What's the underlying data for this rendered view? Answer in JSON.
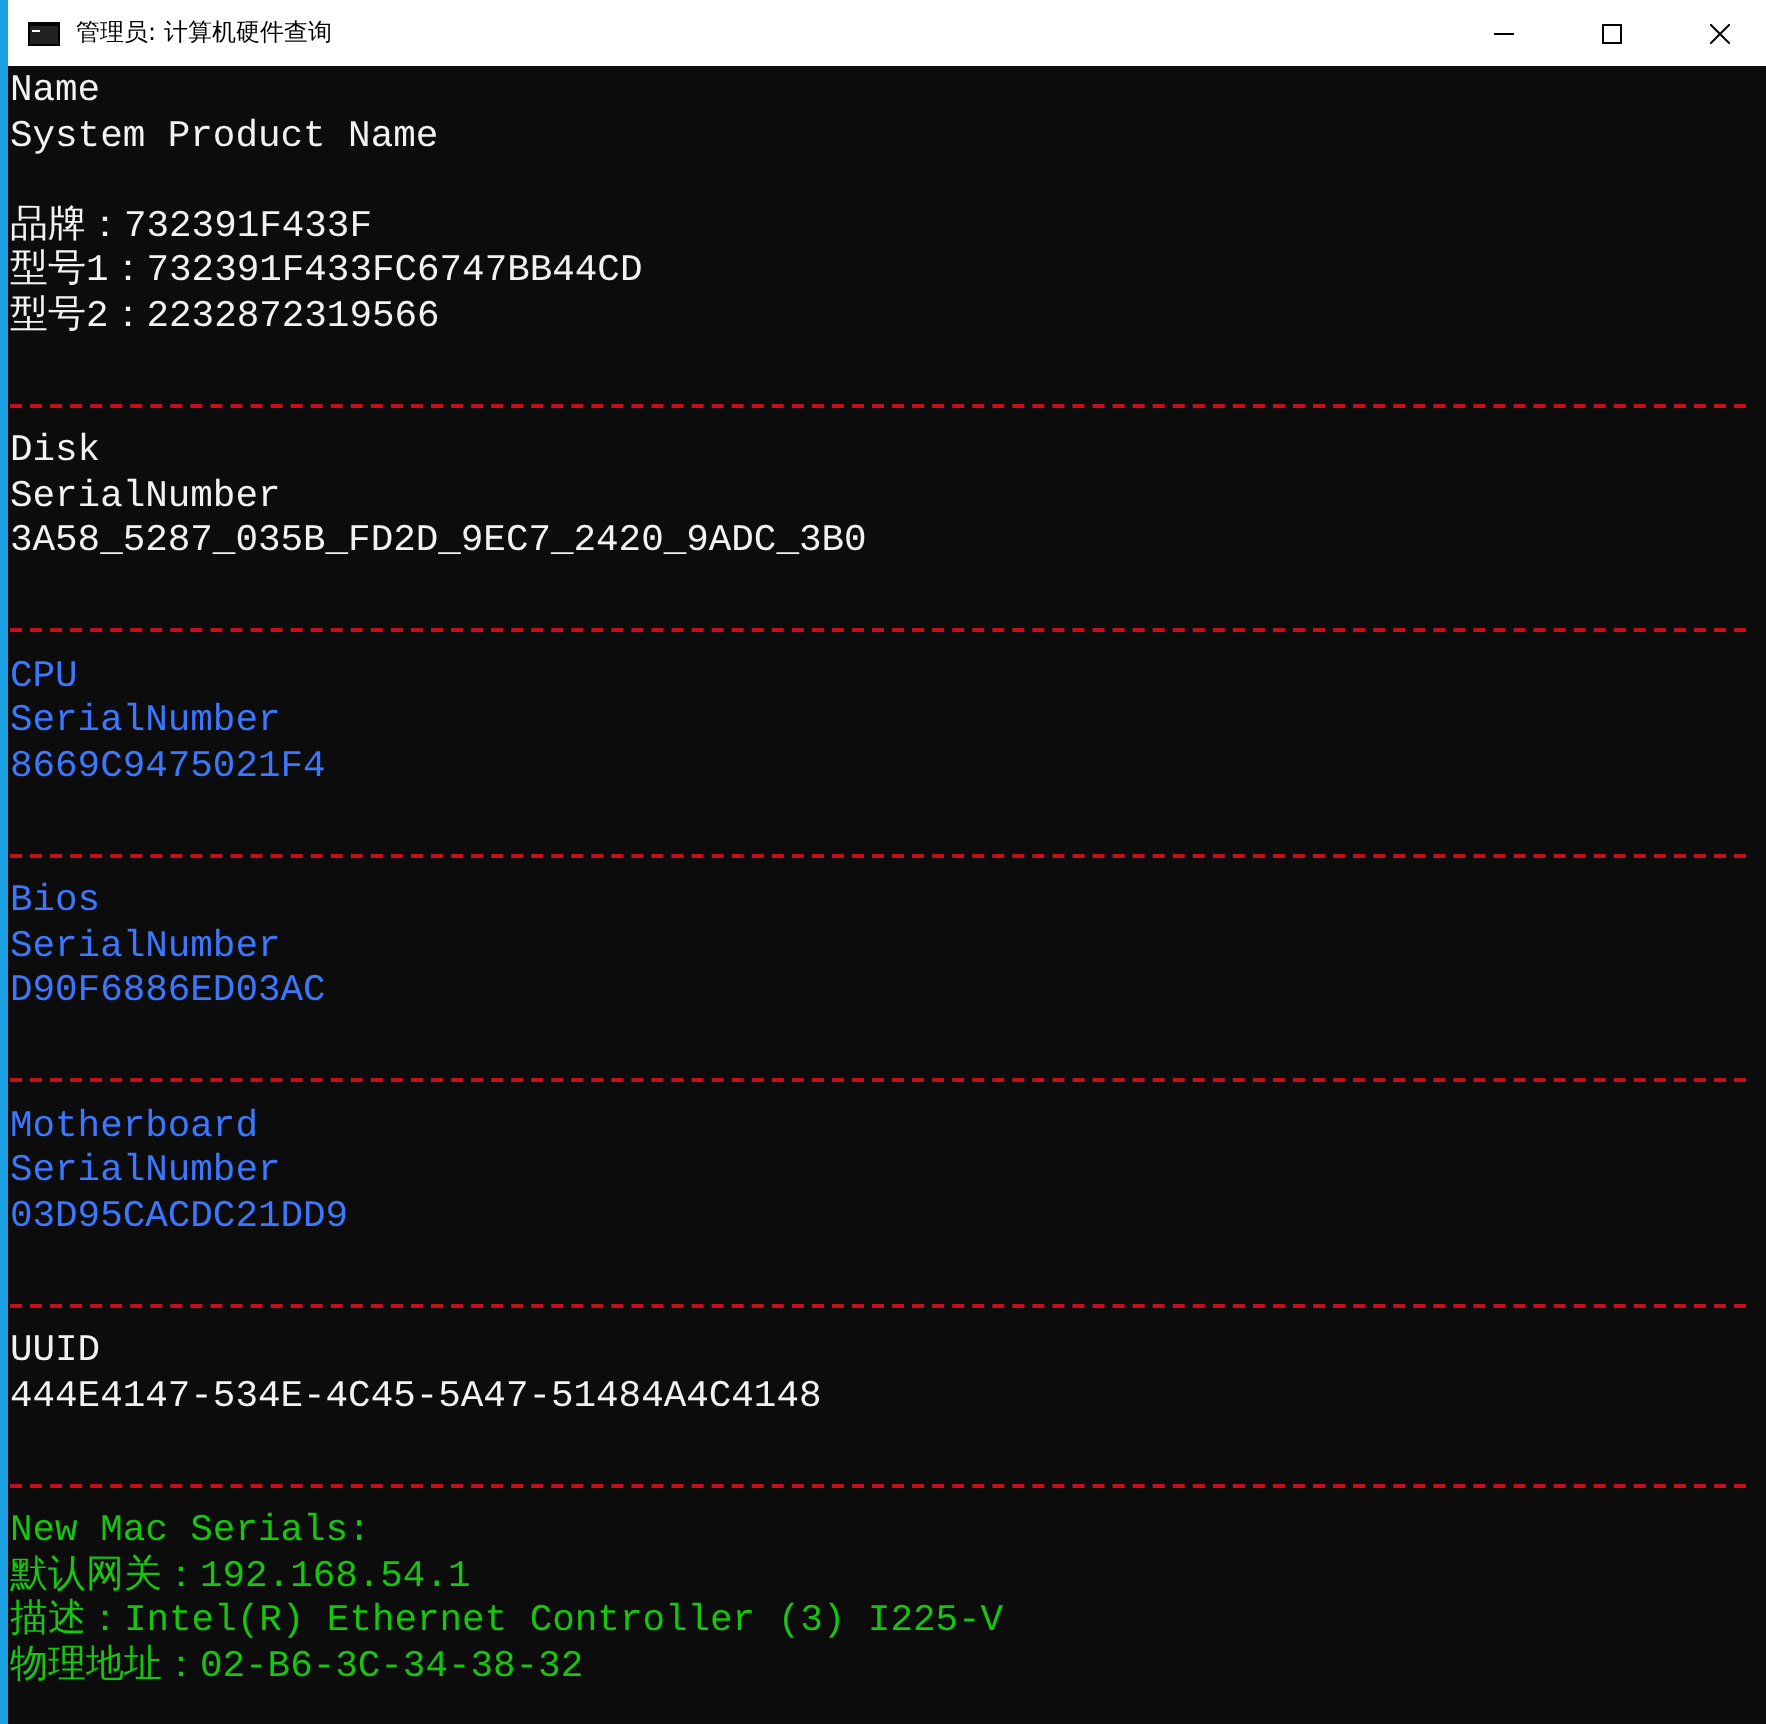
{
  "window": {
    "title": "管理员:  计算机硬件查询"
  },
  "console": {
    "lines": [
      {
        "kind": "text",
        "text": "Name",
        "color": "#f2f2f2"
      },
      {
        "kind": "text",
        "text": "System Product Name",
        "color": "#f2f2f2"
      },
      {
        "kind": "blank"
      },
      {
        "kind": "text",
        "text": "品牌：732391F433F",
        "color": "#f2f2f2"
      },
      {
        "kind": "text",
        "text": "型号1：732391F433FC6747BB44CD",
        "color": "#f2f2f2"
      },
      {
        "kind": "text",
        "text": "型号2：2232872319566",
        "color": "#f2f2f2"
      },
      {
        "kind": "blank"
      },
      {
        "kind": "separator"
      },
      {
        "kind": "text",
        "text": "Disk",
        "color": "#f2f2f2"
      },
      {
        "kind": "text",
        "text": "SerialNumber",
        "color": "#f2f2f2"
      },
      {
        "kind": "text",
        "text": "3A58_5287_035B_FD2D_9EC7_2420_9ADC_3B0",
        "color": "#f2f2f2"
      },
      {
        "kind": "blank"
      },
      {
        "kind": "separator"
      },
      {
        "kind": "text",
        "text": "CPU",
        "color": "#3b78ff"
      },
      {
        "kind": "text",
        "text": "SerialNumber",
        "color": "#3b78ff"
      },
      {
        "kind": "text",
        "text": "8669C9475021F4",
        "color": "#3b78ff"
      },
      {
        "kind": "blank"
      },
      {
        "kind": "separator"
      },
      {
        "kind": "text",
        "text": "Bios",
        "color": "#3b78ff"
      },
      {
        "kind": "text",
        "text": "SerialNumber",
        "color": "#3b78ff"
      },
      {
        "kind": "text",
        "text": "D90F6886ED03AC",
        "color": "#3b78ff"
      },
      {
        "kind": "blank"
      },
      {
        "kind": "separator"
      },
      {
        "kind": "text",
        "text": "Motherboard",
        "color": "#3b78ff"
      },
      {
        "kind": "text",
        "text": "SerialNumber",
        "color": "#3b78ff"
      },
      {
        "kind": "text",
        "text": "03D95CACDC21DD9",
        "color": "#3b78ff"
      },
      {
        "kind": "blank"
      },
      {
        "kind": "separator"
      },
      {
        "kind": "text",
        "text": "UUID",
        "color": "#f2f2f2"
      },
      {
        "kind": "text",
        "text": "444E4147-534E-4C45-5A47-51484A4C4148",
        "color": "#f2f2f2"
      },
      {
        "kind": "blank"
      },
      {
        "kind": "separator"
      },
      {
        "kind": "text",
        "text": "New Mac Serials:",
        "color": "#16c60c"
      },
      {
        "kind": "text",
        "text": "默认网关：192.168.54.1",
        "color": "#16c60c"
      },
      {
        "kind": "text",
        "text": "描述：Intel(R) Ethernet Controller (3) I225-V",
        "color": "#16c60c"
      },
      {
        "kind": "text",
        "text": "物理地址：02-B6-3C-34-38-32",
        "color": "#16c60c"
      }
    ]
  }
}
